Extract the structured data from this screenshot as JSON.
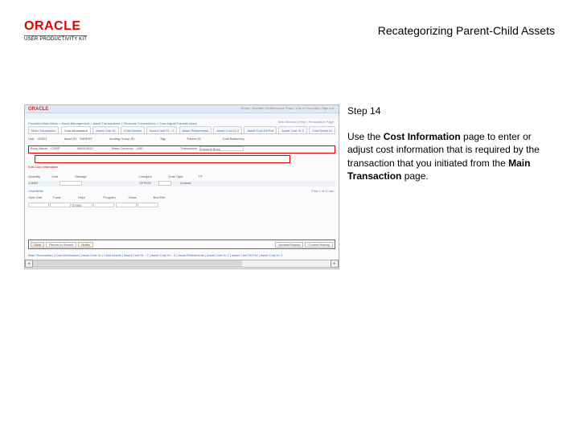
{
  "logo": {
    "brand": "ORACLE",
    "subline": "USER PRODUCTIVITY KIT"
  },
  "doc_title": "Recategorizing Parent-Child Assets",
  "step_label": "Step 14",
  "instruction": {
    "pre": "Use the ",
    "b1": "Cost Information",
    "mid": " page to enter or adjust cost information that is required by the transaction that you initiated from the ",
    "b2": "Main Transaction",
    "post": " page."
  },
  "shot": {
    "oracle": "ORACLE",
    "menu": "Home    |    Worklist    |    Performance Trace    |    Add to Favorites    |    Sign out",
    "breadcrumb": "Favorites    Main Menu > Asset Management > Asset Transactions > Financial Transactions > Cost Adjust/Transfer Asset",
    "welcome": "New Window | Help | Personalize Page",
    "tabs": [
      "Main Transaction",
      "Cost Information",
      "Asset Cost IU",
      "Child Assets",
      "Asset Cost 01 - 2",
      "Asset Retirements",
      "Asset Cost IU 2",
      "Asset Cost Dtl Prd",
      "Asset Cost IU 3",
      "Cost Detail IU"
    ],
    "tab_active": 1,
    "row1": {
      "unit_l": "Unit:",
      "unit": "US001",
      "asset_l": "Asset ID:",
      "asset": "PARENT",
      "acct_l": "Accting Group ID:",
      "tag_l": "Tag:",
      "parent_l": "Parent ID:",
      "co_l": "Cost Balancing"
    },
    "red_row1": {
      "book_l": "Book Name:",
      "book": "CORP",
      "date_l": "",
      "date": "09/01/2012",
      "base_l": "Base Currency:",
      "base": "USD",
      "trans_l": "Transaction",
      "trans": "Interunit Book"
    },
    "red_row2": "Edit Cost Information",
    "mid_labels": {
      "qty": "Quantity",
      "cost": "Cost",
      "salvage": "Salvage",
      "cat": "Category",
      "ct": "Cost Type",
      "tp": "TP"
    },
    "blue_row": {
      "qty": "1.0000",
      "catinp": "OFFICE",
      "inp2": " ",
      "tp": "Leased"
    },
    "grid_hdr": [
      "Chartfields",
      "Oper Unit",
      "Fund",
      "Dept",
      "Program",
      "Class",
      "Bud Ref"
    ],
    "nav": "First   1 of 1   Last",
    "grid_row": [
      "",
      "",
      "37000",
      "",
      "",
      ""
    ],
    "savebar": {
      "save": "Save",
      "ret": "Return to Search",
      "notify": "Notify",
      "upd": "Update/Display",
      "corr": "Correct History"
    },
    "breadtrail": "Main Transaction | Cost Information | Asset Cost IU | Child Assets | Asset Cost 01 - 2 | Asset Cost 01 - 3 | Asset Retirements | Asset Cost IU 2 | Asset Cost Dtl Prd | Asset Cost IU 3",
    "scroll": {
      "l": "◄",
      "r": "►"
    }
  }
}
